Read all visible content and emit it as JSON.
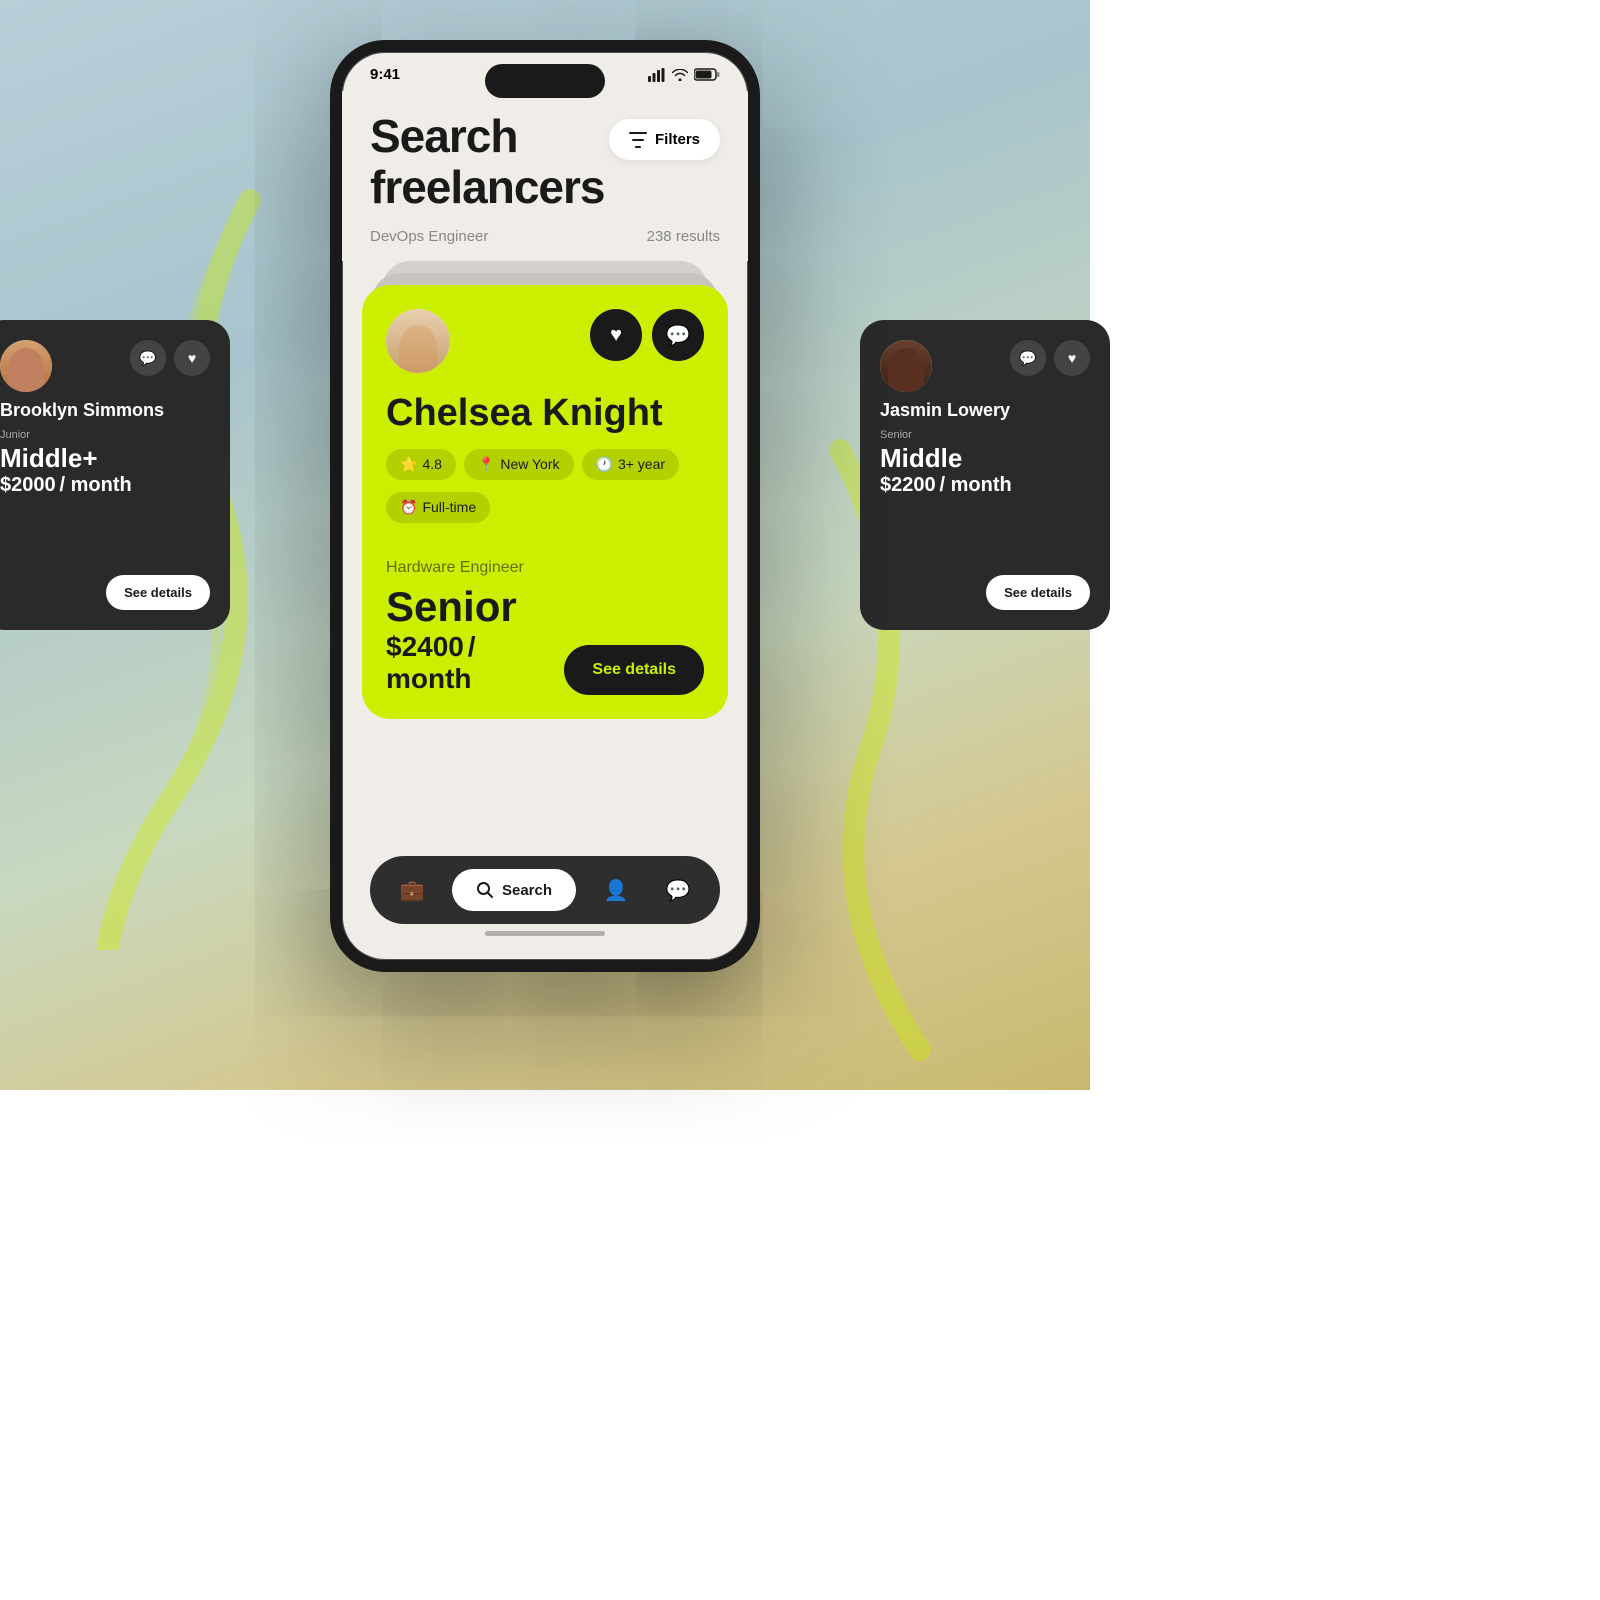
{
  "background": {
    "gradient_start": "#b8cfd8",
    "gradient_end": "#c8b870"
  },
  "status_bar": {
    "time": "9:41",
    "signal_icon": "signal",
    "wifi_icon": "wifi",
    "battery_icon": "battery"
  },
  "header": {
    "title_line1": "Search",
    "title_line2": "freelancers",
    "filters_label": "Filters",
    "search_query": "DevOps Engineer",
    "results_count": "238 results"
  },
  "featured_card": {
    "name": "Chelsea Knight",
    "rating": "4.8",
    "location": "New York",
    "experience": "3+ year",
    "work_type": "Full-time",
    "role": "Hardware Engineer",
    "level": "Senior",
    "price": "$2400",
    "price_suffix": "/ month",
    "see_details_label": "See details",
    "like_icon": "♥",
    "message_icon": "💬"
  },
  "left_card": {
    "name": "Brooklyn Simmons",
    "level_label": "Junior",
    "level": "Middle+",
    "price": "$2000",
    "price_suffix": "/ month",
    "see_details_label": "See details"
  },
  "right_card": {
    "name": "Jasmin Lowery",
    "level_label": "Senior",
    "level": "Middle",
    "price": "$2200",
    "price_suffix": "/ month",
    "see_details_label": "See details"
  },
  "bottom_nav": {
    "briefcase_icon": "💼",
    "search_label": "Search",
    "profile_icon": "👤",
    "message_icon": "💬"
  },
  "colors": {
    "accent": "#ccee00",
    "dark": "#1a1a1a",
    "card_bg_dark": "#2a2a2a",
    "phone_bg": "#f0ede8"
  }
}
